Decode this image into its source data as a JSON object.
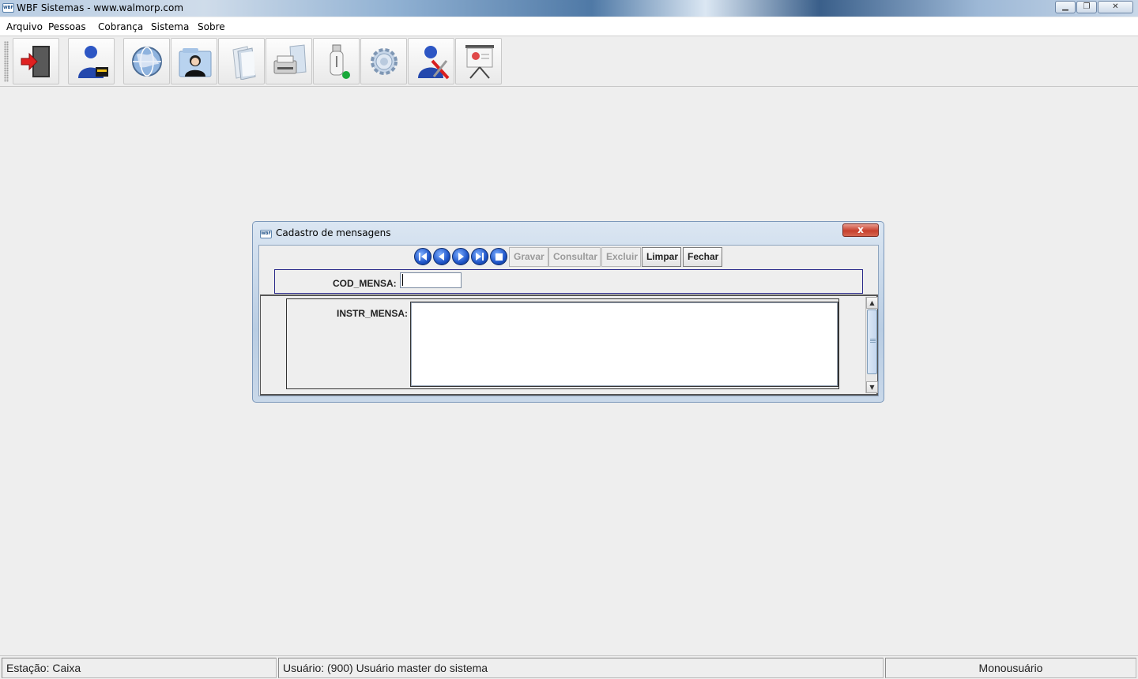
{
  "app": {
    "title": "WBF Sistemas - www.walmorp.com",
    "logo_text": "WBF",
    "window_controls": {
      "minimize": "▁",
      "maximize": "❐",
      "close": "✕"
    }
  },
  "menu": {
    "items": [
      "Arquivo",
      "Pessoas",
      "Cobrança",
      "Sistema",
      "Sobre"
    ]
  },
  "toolbar": {
    "buttons": [
      {
        "icon": "exit-icon"
      },
      {
        "icon": "user-lock-icon"
      },
      {
        "icon": "globe-icon"
      },
      {
        "icon": "contacts-icon"
      },
      {
        "icon": "documents-icon"
      },
      {
        "icon": "printer-icon"
      },
      {
        "icon": "usb-drive-icon"
      },
      {
        "icon": "settings-icon"
      },
      {
        "icon": "user-tools-icon"
      },
      {
        "icon": "presentation-icon"
      }
    ]
  },
  "dialog": {
    "title": "Cadastro de mensagens",
    "logo_text": "WBF",
    "close_label": "x",
    "nav": {
      "first": "first-record-icon",
      "prev": "previous-record-icon",
      "next": "next-record-icon",
      "last": "last-record-icon",
      "stop": "stop-icon"
    },
    "actions": {
      "gravar": "Gravar",
      "consultar": "Consultar",
      "excluir": "Excluir",
      "limpar": "Limpar",
      "fechar": "Fechar"
    },
    "fields": {
      "cod_mensa_label": "COD_MENSA:",
      "cod_mensa_value": "",
      "instr_mensa_label": "INSTR_MENSA:",
      "instr_mensa_value": ""
    }
  },
  "status": {
    "station": "Estação: Caixa",
    "user": "Usuário: (900) Usuário master do sistema",
    "mode": "Monousuário"
  },
  "colors": {
    "accent_blue": "#1f55c8",
    "close_red": "#c8402d",
    "panel_border": "#2a2a8a"
  }
}
